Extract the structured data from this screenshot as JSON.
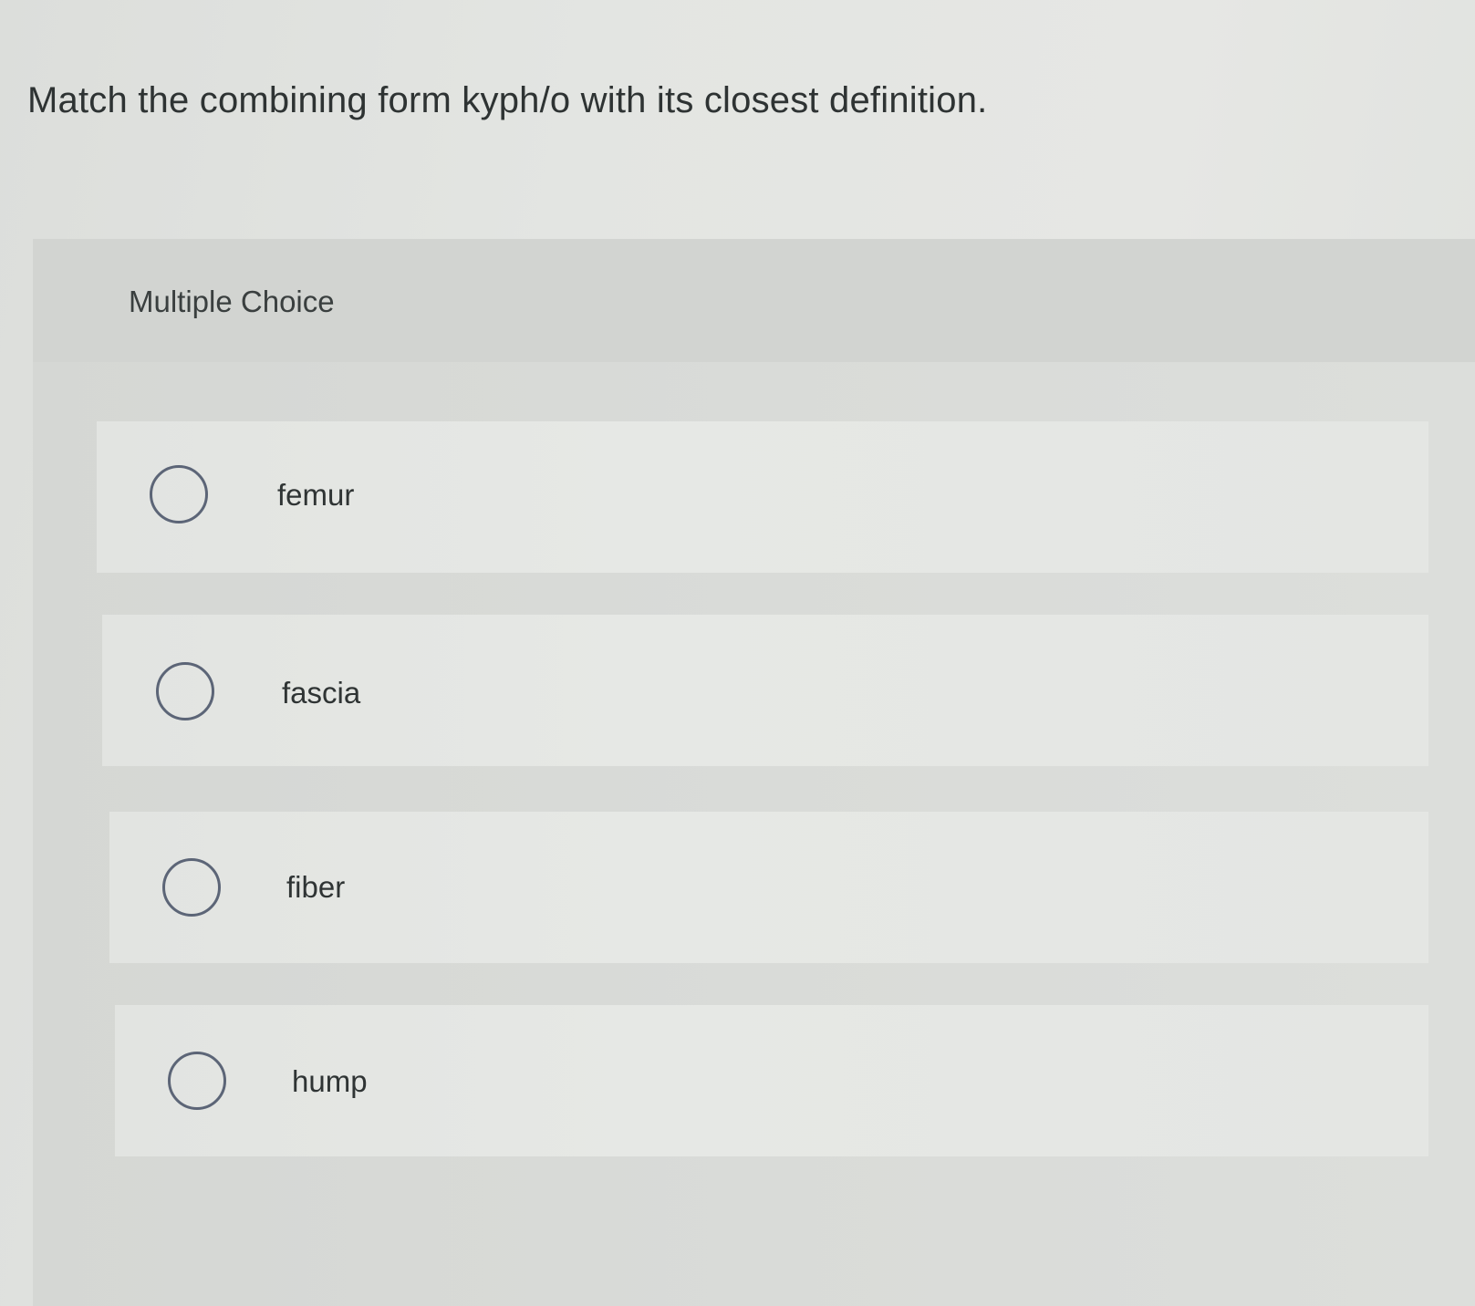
{
  "question": {
    "text": "Match the combining form kyph/o with its closest definition."
  },
  "multiple_choice": {
    "label": "Multiple Choice",
    "options": [
      {
        "label": "femur",
        "selected": false
      },
      {
        "label": "fascia",
        "selected": false
      },
      {
        "label": "fiber",
        "selected": false
      },
      {
        "label": "hump",
        "selected": false
      }
    ]
  }
}
